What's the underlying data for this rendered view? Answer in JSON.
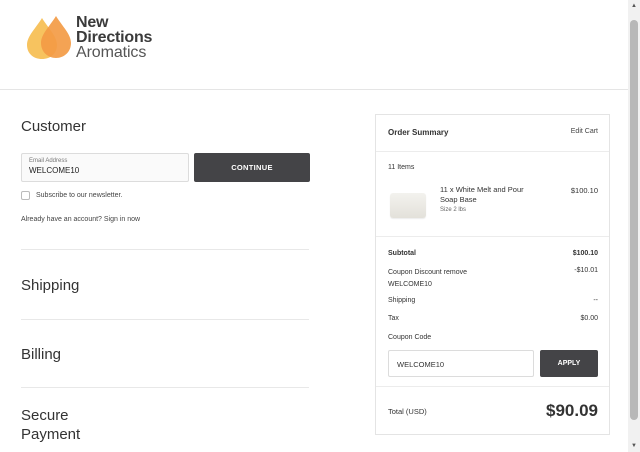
{
  "brand": {
    "line1": "New",
    "line2": "Directions",
    "line3": "Aromatics",
    "colors": {
      "drop_left": "#F7C35F",
      "drop_right": "#F39B45"
    }
  },
  "customer": {
    "title": "Customer",
    "email_label": "Email Address",
    "email_value": "WELCOME10",
    "continue_label": "CONTINUE",
    "newsletter_label": "Subscribe to our newsletter.",
    "account_text": "Already have an account? Sign in now"
  },
  "sections": {
    "shipping": "Shipping",
    "billing": "Billing",
    "payment": "Secure Payment"
  },
  "summary": {
    "title": "Order Summary",
    "edit_cart": "Edit Cart",
    "items_count": "11 Items",
    "product": {
      "name": "11 x White Melt and Pour Soap Base",
      "size": "Size 2 lbs",
      "price": "$100.10"
    },
    "subtotal_label": "Subtotal",
    "subtotal_value": "$100.10",
    "coupon_label": "Coupon Discount remove WELCOME10",
    "coupon_value": "-$10.01",
    "shipping_label": "Shipping",
    "shipping_value": "--",
    "tax_label": "Tax",
    "tax_value": "$0.00",
    "coupon_code_label": "Coupon Code",
    "coupon_code_value": "WELCOME10",
    "apply_label": "APPLY",
    "total_label": "Total (USD)",
    "total_value": "$90.09"
  },
  "icons": {
    "logo": "droplets-logo-icon",
    "scroll_up": "scroll-up-arrow-icon",
    "scroll_down": "scroll-down-arrow-icon"
  }
}
